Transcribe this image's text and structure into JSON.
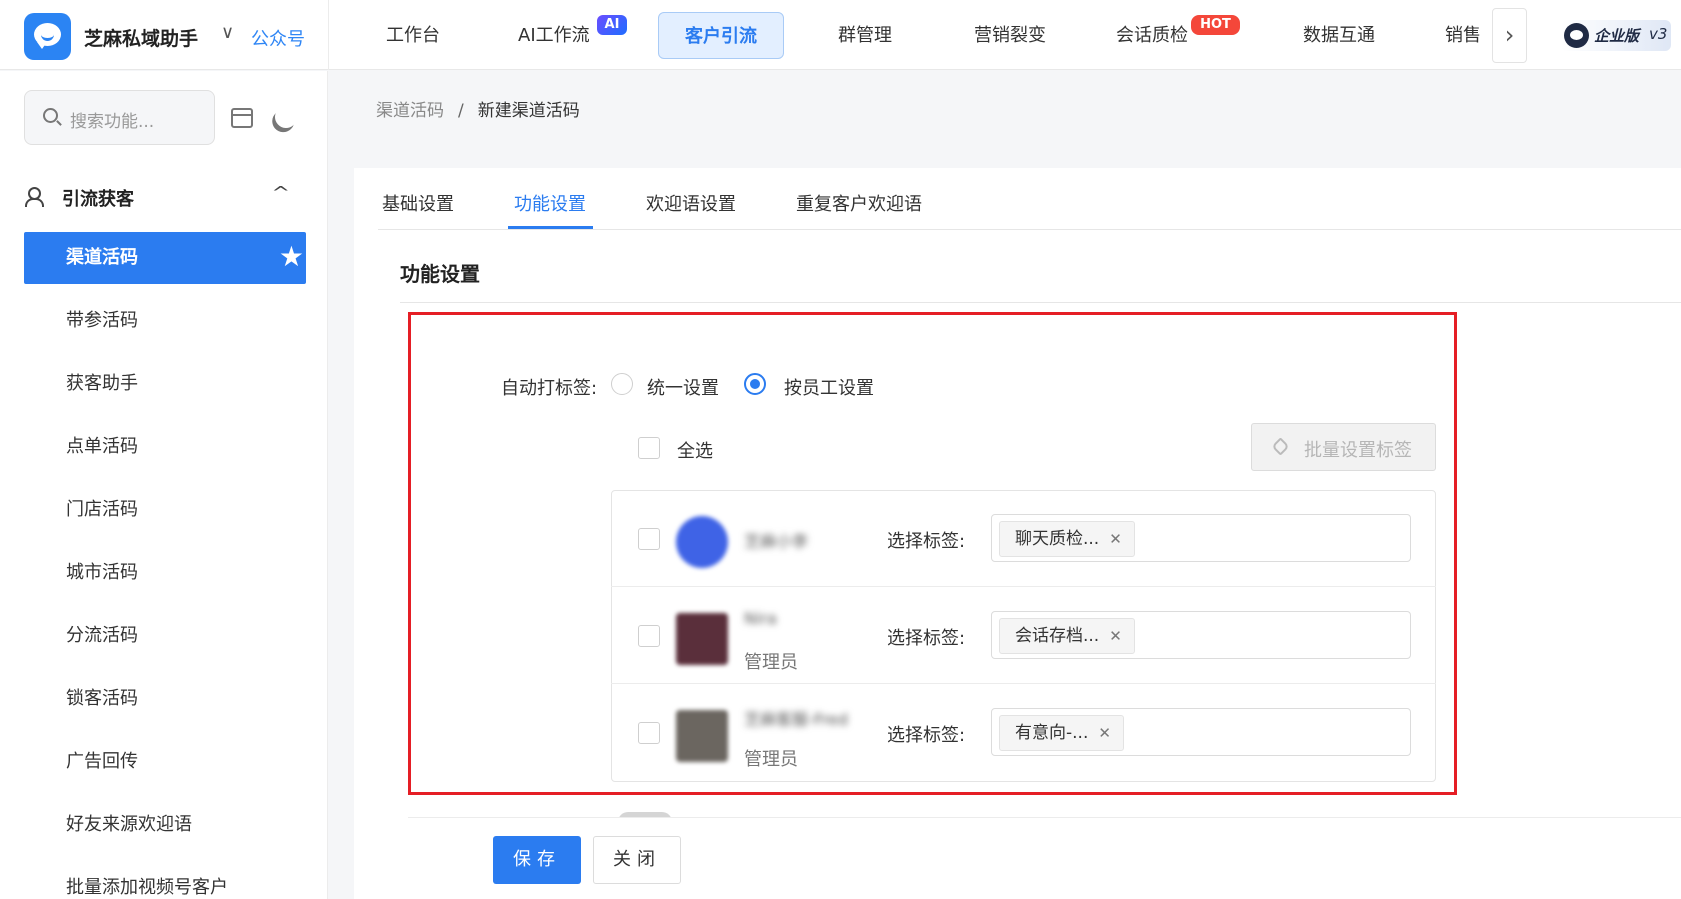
{
  "brand": {
    "name": "芝麻私域助手",
    "account_type": "公众号"
  },
  "nav": {
    "items": [
      "工作台",
      "AI工作流",
      "客户引流",
      "群管理",
      "营销裂变",
      "会话质检",
      "数据互通",
      "销售"
    ],
    "active": "客户引流",
    "badge_ai": "AI",
    "badge_hot": "HOT",
    "next_icon": "chevron-right-icon"
  },
  "edition": {
    "label": "企业版",
    "version": "v3"
  },
  "sidebar": {
    "search_placeholder": "搜索功能...",
    "group_label": "引流获客",
    "items": [
      "渠道活码",
      "带参活码",
      "获客助手",
      "点单活码",
      "门店活码",
      "城市活码",
      "分流活码",
      "锁客活码",
      "广告回传",
      "好友来源欢迎语",
      "批量添加视频号客户"
    ],
    "active": "渠道活码"
  },
  "breadcrumb": {
    "parent": "渠道活码",
    "separator": "/",
    "current": "新建渠道活码"
  },
  "tabs": {
    "items": [
      "基础设置",
      "功能设置",
      "欢迎语设置",
      "重复客户欢迎语"
    ],
    "active": "功能设置"
  },
  "section": {
    "title": "功能设置"
  },
  "auto_tag": {
    "label": "自动打标签:",
    "options": [
      "统一设置",
      "按员工设置"
    ],
    "selected": "按员工设置"
  },
  "select_all_label": "全选",
  "batch_tag_button": "批量设置标签",
  "staff": [
    {
      "name": "芝麻小李",
      "role": "",
      "tag_label": "选择标签:",
      "tag": "聊天质检...",
      "avatar_color": "#3f63e6"
    },
    {
      "name": "Nira",
      "role": "管理员",
      "tag_label": "选择标签:",
      "tag": "会话存档...",
      "avatar_color": "#5a2f3b"
    },
    {
      "name": "芝麻客服-Fred",
      "role": "管理员",
      "tag_label": "选择标签:",
      "tag": "有意向-...",
      "avatar_color": "#6b6660"
    }
  ],
  "footer": {
    "save": "保存",
    "close": "关闭"
  },
  "colors": {
    "primary": "#2b7cf0",
    "highlight": "#e51e25",
    "hot": "#f4473a"
  }
}
